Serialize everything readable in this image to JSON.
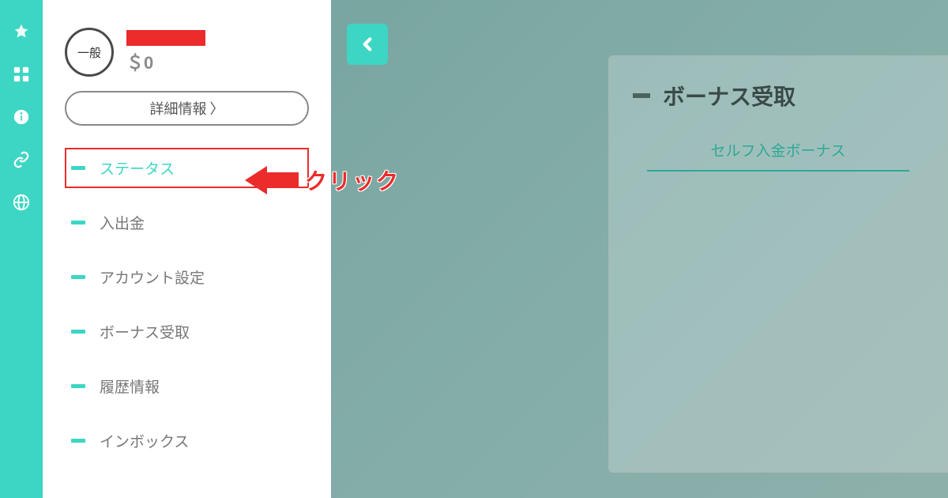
{
  "iconRail": {
    "icons": [
      "medal-icon",
      "grid-icon",
      "info-icon",
      "link-icon",
      "globe-icon"
    ]
  },
  "sidebar": {
    "userBadge": "一般",
    "balance": "＄0",
    "detailsButton": "詳細情報",
    "menu": [
      {
        "label": "ステータス",
        "active": true,
        "highlighted": true
      },
      {
        "label": "入出金",
        "active": false,
        "highlighted": false
      },
      {
        "label": "アカウント設定",
        "active": false,
        "highlighted": false
      },
      {
        "label": "ボーナス受取",
        "active": false,
        "highlighted": false
      },
      {
        "label": "履歴情報",
        "active": false,
        "highlighted": false
      },
      {
        "label": "インボックス",
        "active": false,
        "highlighted": false
      }
    ]
  },
  "annotation": {
    "text": "クリック"
  },
  "main": {
    "card": {
      "title": "ボーナス受取",
      "tab": "セルフ入金ボーナス"
    }
  },
  "colors": {
    "accent": "#3dd6c4",
    "highlight": "#ec2b2b"
  }
}
